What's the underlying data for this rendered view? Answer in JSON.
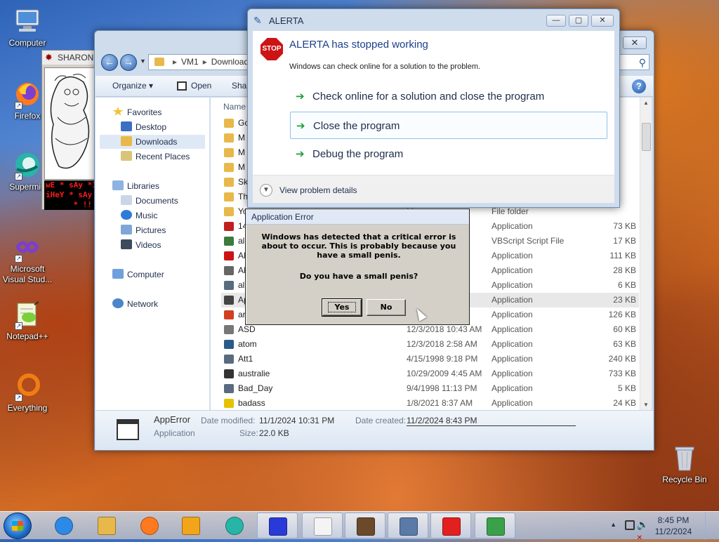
{
  "desktop": {
    "icons": [
      {
        "label": "Computer",
        "icon": "computer-icon"
      },
      {
        "label": "Firefox",
        "icon": "firefox-icon"
      },
      {
        "label": "Supermiu",
        "icon": "supermium-icon"
      },
      {
        "label": "Microsoft Visual Stud...",
        "icon": "visual-studio-icon"
      },
      {
        "label": "Notepad++",
        "icon": "notepadpp-icon"
      },
      {
        "label": "Everything",
        "icon": "everything-icon"
      },
      {
        "label": "Recycle Bin",
        "icon": "recycle-bin-icon"
      }
    ]
  },
  "sharon": {
    "title": "SHARON",
    "banner": [
      "wE * sAy *I",
      "iHeY * sAy *",
      "* !!"
    ]
  },
  "explorer": {
    "close": "✕",
    "address": {
      "root": "VM1",
      "folder": "Download"
    },
    "toolbar": {
      "organize": "Organize ▾",
      "open": "Open",
      "share": "Sha"
    },
    "column_name": "Name",
    "nav": {
      "favorites": "Favorites",
      "desktop": "Desktop",
      "downloads": "Downloads",
      "recent": "Recent Places",
      "libraries": "Libraries",
      "documents": "Documents",
      "music": "Music",
      "pictures": "Pictures",
      "videos": "Videos",
      "computer": "Computer",
      "network": "Network"
    },
    "files": [
      {
        "name": "Gc",
        "date": "",
        "type": "",
        "size": "",
        "color": "#e8b84a"
      },
      {
        "name": "M",
        "date": "",
        "type": "",
        "size": "",
        "color": "#e8b84a"
      },
      {
        "name": "M",
        "date": "",
        "type": "",
        "size": "",
        "color": "#e8b84a"
      },
      {
        "name": "M",
        "date": "",
        "type": "",
        "size": "",
        "color": "#e8b84a"
      },
      {
        "name": "Sk",
        "date": "",
        "type": "",
        "size": "",
        "color": "#e8b84a"
      },
      {
        "name": "Th",
        "date": "",
        "type": "",
        "size": "",
        "color": "#e8b84a"
      },
      {
        "name": "Yo",
        "date": "M",
        "type": "File folder",
        "size": "",
        "color": "#e8b84a"
      },
      {
        "name": "14",
        "date": "M",
        "type": "Application",
        "size": "73 KB",
        "color": "#c02020"
      },
      {
        "name": "al",
        "date": "M",
        "type": "VBScript Script File",
        "size": "17 KB",
        "color": "#3d7a3d"
      },
      {
        "name": "Al",
        "date": "M",
        "type": "Application",
        "size": "111 KB",
        "color": "#cc1414"
      },
      {
        "name": "Al",
        "date": "M",
        "type": "Application",
        "size": "28 KB",
        "color": "#666666"
      },
      {
        "name": "al",
        "date": "M",
        "type": "Application",
        "size": "6 KB",
        "color": "#5a6b80"
      },
      {
        "name": "Ap",
        "date": "M",
        "type": "Application",
        "size": "23 KB",
        "color": "#444444"
      },
      {
        "name": "ar",
        "date": "M",
        "type": "Application",
        "size": "126 KB",
        "color": "#d04020"
      },
      {
        "name": "ASD",
        "date": "12/3/2018 10:43 AM",
        "type": "Application",
        "size": "60 KB",
        "color": "#777777"
      },
      {
        "name": "atom",
        "date": "12/3/2018 2:58 AM",
        "type": "Application",
        "size": "63 KB",
        "color": "#2a5a8a"
      },
      {
        "name": "Att1",
        "date": "4/15/1998 9:18 PM",
        "type": "Application",
        "size": "240 KB",
        "color": "#5a6b80"
      },
      {
        "name": "australie",
        "date": "10/29/2009 4:45 AM",
        "type": "Application",
        "size": "733 KB",
        "color": "#333333"
      },
      {
        "name": "Bad_Day",
        "date": "9/4/1998 11:13 PM",
        "type": "Application",
        "size": "5 KB",
        "color": "#5a6b80"
      },
      {
        "name": "badass",
        "date": "1/8/2021 8:37 AM",
        "type": "Application",
        "size": "24 KB",
        "color": "#e6c200"
      }
    ],
    "details": {
      "name": "AppError",
      "type": "Application",
      "modified_label": "Date modified:",
      "modified": "11/1/2024 10:31 PM",
      "size_label": "Size:",
      "size": "22.0 KB",
      "created_label": "Date created:",
      "created": "11/2/2024 8:43 PM"
    }
  },
  "alerta": {
    "title": "ALERTA",
    "stop": "STOP",
    "headline": "ALERTA has stopped working",
    "sub": "Windows can check online for a solution to the problem.",
    "options": [
      "Check online for a solution and close the program",
      "Close the program",
      "Debug the program"
    ],
    "arrow": "➔",
    "details": "View problem details",
    "minimize": "—",
    "maximize": "▢",
    "close": "✕"
  },
  "app_error": {
    "title": "Application Error",
    "message": "Windows has detected that a critical error is about to occur. This is probably because you have a small penis.",
    "question": "Do you have a small penis?",
    "yes": "Yes",
    "no": "No"
  },
  "taskbar": {
    "items": [
      "explorer-icon",
      "ie-icon",
      "folder-icon",
      "firefox-icon",
      "media-icon",
      "supermium-icon",
      "virus-icon",
      "notepad-icon",
      "photo-icon",
      "computer-app-icon",
      "runner-icon",
      "shield-check-icon"
    ],
    "time": "8:45 PM",
    "date": "11/2/2024"
  }
}
